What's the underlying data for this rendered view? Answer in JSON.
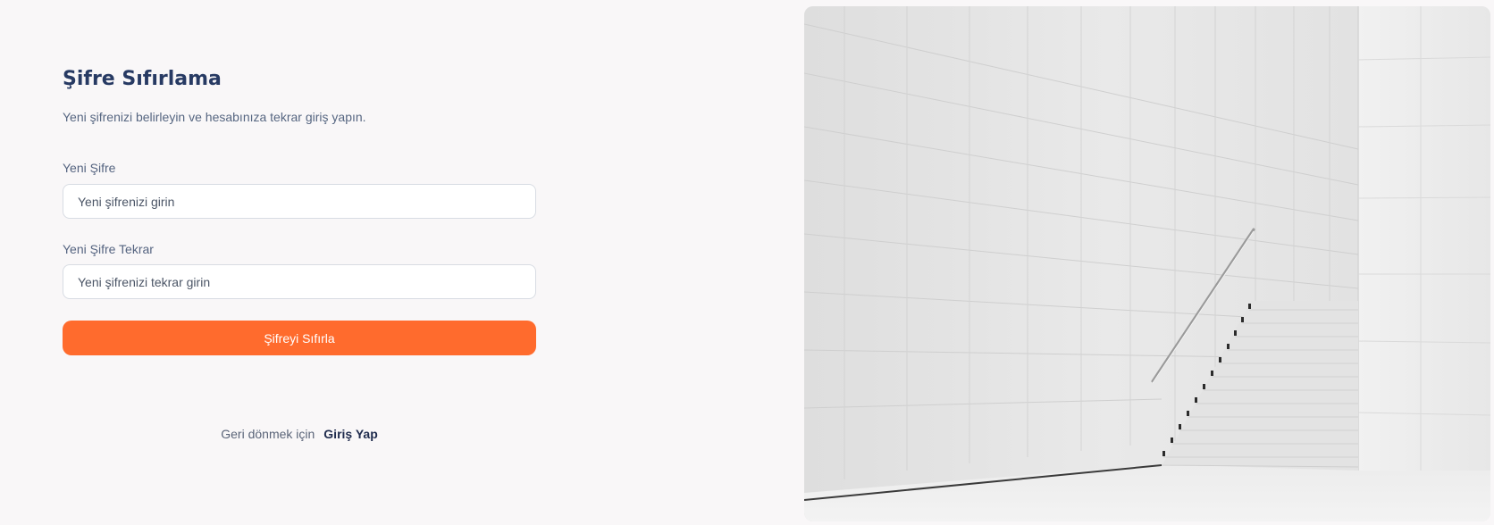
{
  "reset_form": {
    "title": "Şifre Sıfırlama",
    "subtitle": "Yeni şifrenizi belirleyin ve hesabınıza tekrar giriş yapın.",
    "new_password": {
      "label": "Yeni Şifre",
      "placeholder": "Yeni şifrenizi girin",
      "value": ""
    },
    "confirm_password": {
      "label": "Yeni Şifre Tekrar",
      "placeholder": "Yeni şifrenizi tekrar girin",
      "value": ""
    },
    "submit_label": "Şifreyi Sıfırla",
    "back_text": "Geri dönmek için",
    "back_link": "Giriş Yap"
  },
  "colors": {
    "accent": "#ff6b2d",
    "title": "#273a63",
    "background": "#f9f7f8"
  }
}
